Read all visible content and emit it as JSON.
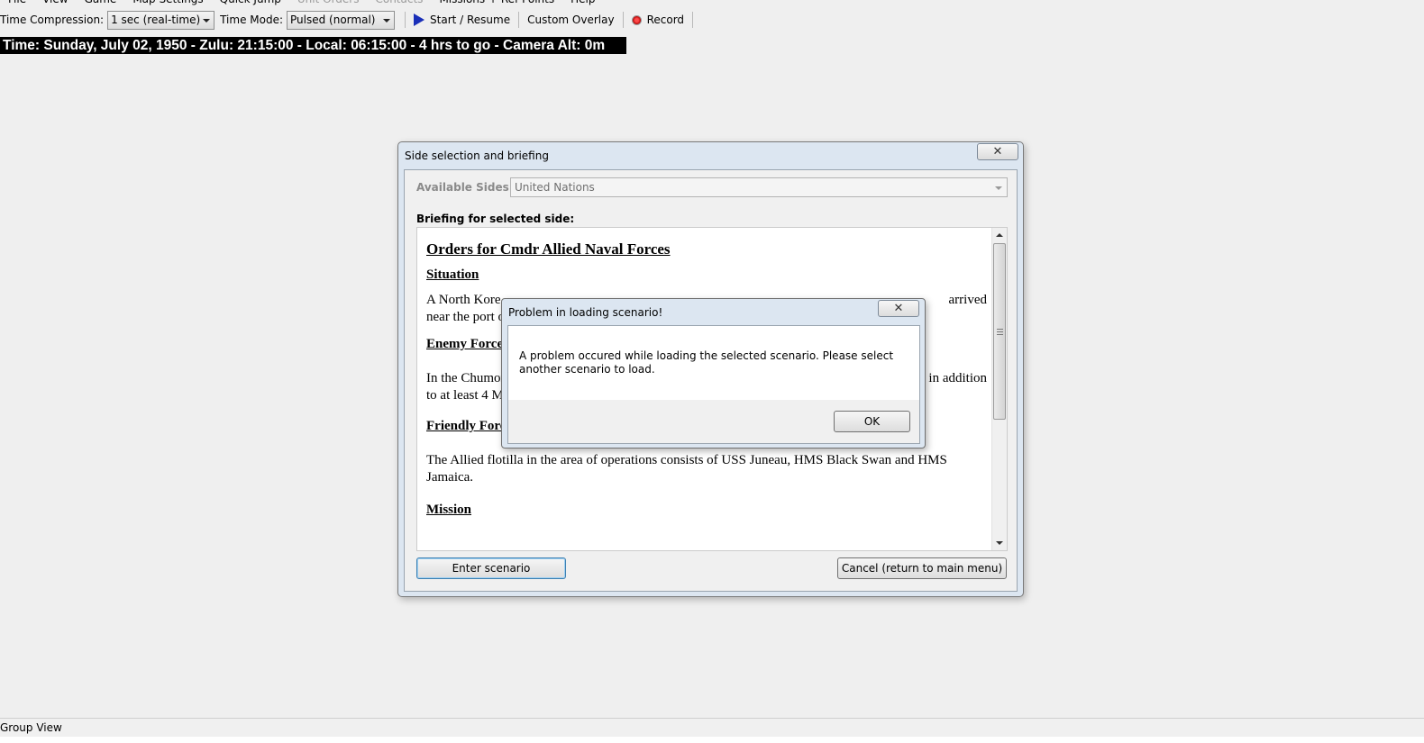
{
  "menu": {
    "items": [
      "File",
      "View",
      "Game",
      "Map Settings",
      "Quick Jump",
      "Unit Orders",
      "Contacts",
      "Missions + Ref Points",
      "Help"
    ],
    "disabled": [
      "Unit Orders",
      "Contacts"
    ]
  },
  "toolbar": {
    "time_compression_label": "Time Compression:",
    "time_compression_value": "1 sec (real-time)",
    "time_mode_label": "Time Mode:",
    "time_mode_value": "Pulsed (normal)",
    "start_label": "Start / Resume",
    "custom_overlay_label": "Custom Overlay",
    "record_label": "Record"
  },
  "time_banner": "Time: Sunday, July 02, 1950 - Zulu: 21:15:00 - Local: 06:15:00 - 4 hrs to go -  Camera Alt: 0m",
  "side_dialog": {
    "title": "Side selection and briefing",
    "available_sides_label": "Available Sides:",
    "available_sides_value": "United Nations",
    "briefing_label": "Briefing for selected side:",
    "briefing": {
      "heading": "Orders for Cmdr Allied Naval Forces",
      "situation_heading": "Situation",
      "situation_text": "A North Kore",
      "situation_text_end": "arrived",
      "situation_text_2": "near the port o",
      "enemy_heading": "Enemy Force",
      "enemy_text": "In the Chumon",
      "enemy_text_end": "in addition",
      "enemy_text_2": "to at least 4 M",
      "friendly_heading": "Friendly Forc",
      "friendly_text": "The Allied flotilla in the area of operations consists of USS Juneau, HMS Black Swan and HMS Jamaica.",
      "mission_heading": "Mission"
    },
    "enter_button": "Enter scenario",
    "cancel_button": "Cancel (return to main menu)",
    "close_glyph": "✕"
  },
  "error_dialog": {
    "title": "Problem in loading scenario!",
    "message": "A problem occured while loading the selected scenario. Please select another scenario to load.",
    "ok_button": "OK",
    "close_glyph": "✕"
  },
  "status_bar": {
    "text": "Group View"
  },
  "colors": {
    "play_icon": "#1a2fb8",
    "record_icon": "#d01010",
    "time_banner_bg": "#000000"
  },
  "icons": {
    "play": "play-icon",
    "record": "record-icon",
    "close": "close-icon"
  }
}
